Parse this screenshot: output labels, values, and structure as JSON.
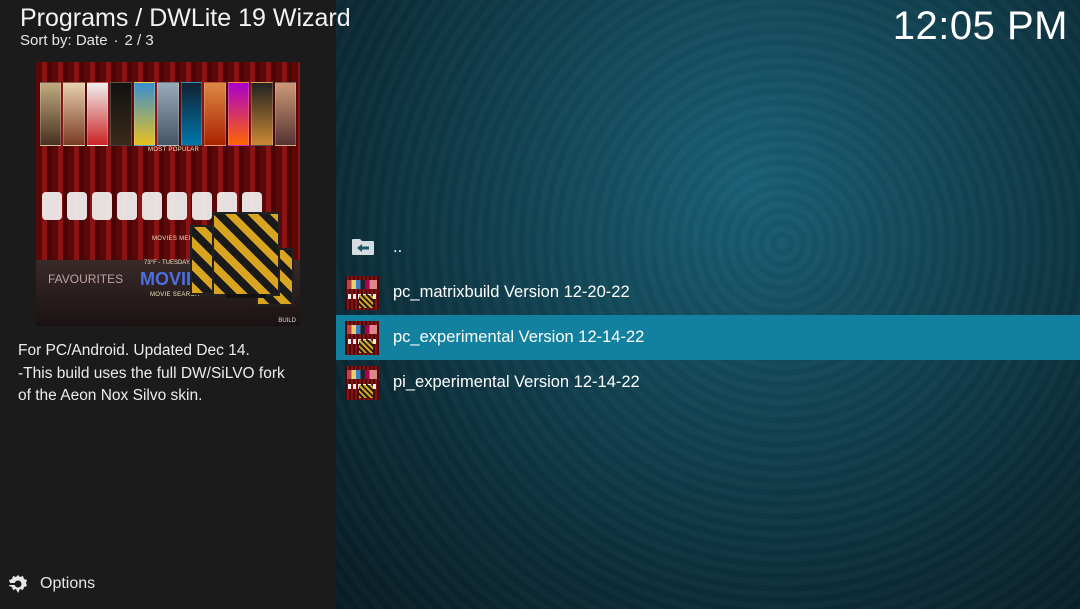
{
  "header": {
    "title": "Programs / DWLite 19 Wizard",
    "sort_label": "Sort by: Date",
    "separator": "·",
    "page_info": "2 / 3"
  },
  "clock": "12:05 PM",
  "fanart": {
    "most_popular": "MOST POPULAR",
    "movies_menu": "MOVIES MENU",
    "favourites": "FAVOURITES",
    "date_line": "73°F - TUESDAY, OCTOBER 8",
    "movies": "MOVIES",
    "movie_search": "MOVIE SEARCH",
    "build_tag": "BUILD"
  },
  "description": {
    "line1": "For PC/Android. Updated Dec 14.",
    "line2": "-This build uses the full DW/SiLVO fork",
    "line3": "of the Aeon Nox Silvo skin."
  },
  "options": {
    "label": "Options",
    "icon": "gear-icon"
  },
  "list": {
    "parent": "..",
    "items": [
      {
        "label": "pc_matrixbuild Version 12-20-22",
        "selected": false
      },
      {
        "label": "pc_experimental Version 12-14-22",
        "selected": true
      },
      {
        "label": "pi_experimental Version 12-14-22",
        "selected": false
      }
    ]
  },
  "colors": {
    "accent": "#12809f",
    "left_panel": "#1b1b1c"
  }
}
